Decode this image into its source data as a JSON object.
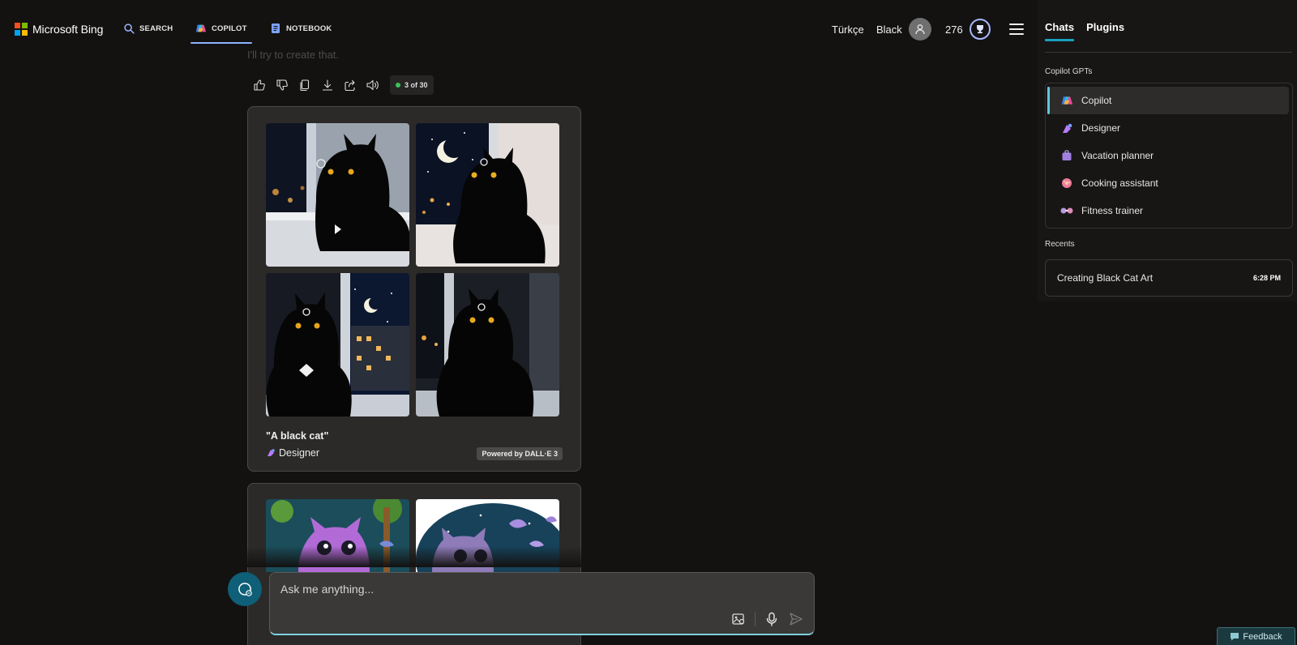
{
  "brand": {
    "name": "Microsoft Bing",
    "colors": [
      "#f25022",
      "#7fba00",
      "#00a4ef",
      "#ffb900"
    ]
  },
  "nav": [
    {
      "label": "SEARCH",
      "icon": "search-icon"
    },
    {
      "label": "COPILOT",
      "icon": "copilot-icon",
      "active": true
    },
    {
      "label": "NOTEBOOK",
      "icon": "notebook-icon"
    }
  ],
  "header": {
    "language": "Türkçe",
    "user": "Black",
    "points": "276"
  },
  "chat": {
    "faded_message": "I'll try to create that.",
    "counter": "3 of 30",
    "card": {
      "caption": "\"A black cat\"",
      "source": "Designer",
      "powered_by": "Powered by DALL·E 3"
    },
    "input_placeholder": "Ask me anything..."
  },
  "sidebar": {
    "tabs": [
      {
        "label": "Chats",
        "active": true
      },
      {
        "label": "Plugins"
      }
    ],
    "gpts_label": "Copilot GPTs",
    "gpts": [
      {
        "label": "Copilot",
        "icon": "copilot-icon",
        "active": true
      },
      {
        "label": "Designer",
        "icon": "designer-icon"
      },
      {
        "label": "Vacation planner",
        "icon": "suitcase-icon"
      },
      {
        "label": "Cooking assistant",
        "icon": "donut-icon"
      },
      {
        "label": "Fitness trainer",
        "icon": "dumbbell-icon"
      }
    ],
    "recents_label": "Recents",
    "recents": [
      {
        "title": "Creating Black Cat Art",
        "time": "6:28 PM"
      }
    ]
  },
  "feedback": {
    "label": "Feedback"
  }
}
